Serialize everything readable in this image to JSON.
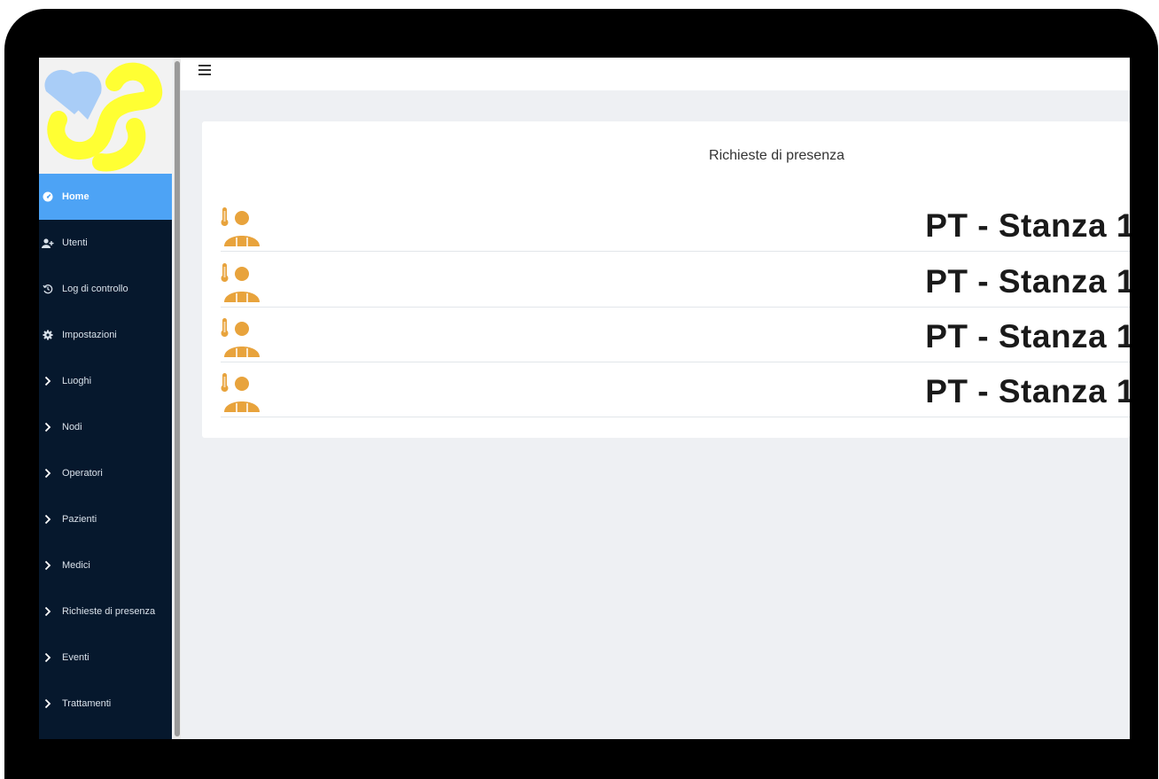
{
  "topbar": {
    "menu_icon": "hamburger-menu-icon"
  },
  "sidebar": {
    "items": [
      {
        "label": "Home",
        "icon": "dashboard-icon",
        "active": true
      },
      {
        "label": "Utenti",
        "icon": "user-plus-icon",
        "active": false
      },
      {
        "label": "Log di controllo",
        "icon": "history-icon",
        "active": false
      },
      {
        "label": "Impostazioni",
        "icon": "gear-icon",
        "active": false
      },
      {
        "label": "Luoghi",
        "icon": "chevron-right-icon",
        "active": false
      },
      {
        "label": "Nodi",
        "icon": "chevron-right-icon",
        "active": false
      },
      {
        "label": "Operatori",
        "icon": "chevron-right-icon",
        "active": false
      },
      {
        "label": "Pazienti",
        "icon": "chevron-right-icon",
        "active": false
      },
      {
        "label": "Medici",
        "icon": "chevron-right-icon",
        "active": false
      },
      {
        "label": "Richieste di presenza",
        "icon": "chevron-right-icon",
        "active": false
      },
      {
        "label": "Eventi",
        "icon": "chevron-right-icon",
        "active": false
      },
      {
        "label": "Trattamenti",
        "icon": "chevron-right-icon",
        "active": false
      }
    ]
  },
  "main": {
    "card_title": "Richieste di presenza",
    "requests": [
      {
        "label": "PT - Stanza 1",
        "icon": "patient-thermometer-icon"
      },
      {
        "label": "PT - Stanza 1",
        "icon": "patient-thermometer-icon"
      },
      {
        "label": "PT - Stanza 1",
        "icon": "patient-thermometer-icon"
      },
      {
        "label": "PT - Stanza 1",
        "icon": "patient-thermometer-icon"
      }
    ]
  },
  "colors": {
    "sidebar_bg": "#06182d",
    "active_item": "#4da3f5",
    "logo_yellow": "#ffff33",
    "logo_blue": "#a9cdf7",
    "patient_icon": "#e8a33c"
  }
}
